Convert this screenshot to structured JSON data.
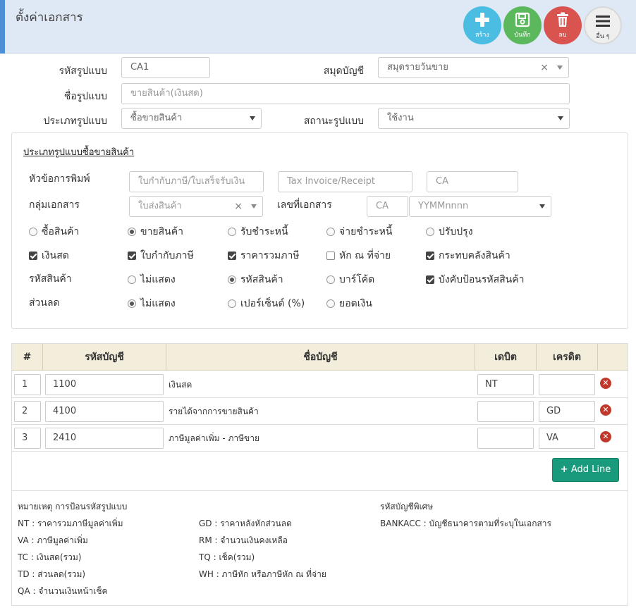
{
  "header": {
    "title": "ตั้งค่าเอกสาร",
    "buttons": {
      "create": "สร้าง",
      "save": "บันทึก",
      "delete": "ลบ",
      "more": "อื่น ๆ"
    }
  },
  "form": {
    "code_label": "รหัสรูปแบบ",
    "code_value": "CA1",
    "journal_label": "สมุดบัญชี",
    "journal_value": "สมุดรายวันขาย",
    "name_label": "ชื่อรูปแบบ",
    "name_placeholder": "ขายสินค้า(เงินสด)",
    "type_label": "ประเภทรูปแบบ",
    "type_value": "ซื้อขายสินค้า",
    "status_label": "สถานะรูปแบบ",
    "status_value": "ใช้งาน"
  },
  "panel": {
    "title": "ประเภทรูปแบบซื้อขายสินค้า",
    "print_title_label": "หัวข้อการพิมพ์",
    "print_title_th_placeholder": "ใบกำกับภาษี/ใบเสร็จรับเงิน",
    "print_title_en_placeholder": "Tax Invoice/Receipt",
    "print_title_code_placeholder": "CA",
    "doc_group_label": "กลุ่มเอกสาร",
    "doc_group_value": "ใบส่งสินค้า",
    "doc_no_label": "เลขที่เอกสาร",
    "doc_no_prefix": "CA",
    "doc_no_format": "YYMMnnnn",
    "trade_options": [
      {
        "label": "ซื้อสินค้า",
        "selected": false
      },
      {
        "label": "ขายสินค้า",
        "selected": true
      },
      {
        "label": "รับชำระหนี้",
        "selected": false
      },
      {
        "label": "จ่ายชำระหนี้",
        "selected": false
      },
      {
        "label": "ปรับปรุง",
        "selected": false
      }
    ],
    "checks": [
      {
        "label": "เงินสด",
        "checked": true
      },
      {
        "label": "ใบกำกับภาษี",
        "checked": true
      },
      {
        "label": "ราคารวมภาษี",
        "checked": true
      },
      {
        "label": "หัก ณ ที่จ่าย",
        "checked": false
      },
      {
        "label": "กระทบคลังสินค้า",
        "checked": true
      }
    ],
    "product_code_label": "รหัสสินค้า",
    "product_code_options": [
      {
        "label": "ไม่แสดง",
        "selected": false
      },
      {
        "label": "รหัสสินค้า",
        "selected": true
      },
      {
        "label": "บาร์โค้ด",
        "selected": false
      }
    ],
    "force_code": {
      "label": "บังคับป้อนรหัสสินค้า",
      "checked": true
    },
    "discount_label": "ส่วนลด",
    "discount_options": [
      {
        "label": "ไม่แสดง",
        "selected": true
      },
      {
        "label": "เปอร์เซ็นต์ (%)",
        "selected": false
      },
      {
        "label": "ยอดเงิน",
        "selected": false
      }
    ]
  },
  "table": {
    "headers": [
      "#",
      "รหัสบัญชี",
      "ชื่อบัญชี",
      "เดบิต",
      "เครดิต"
    ],
    "rows": [
      {
        "no": "1",
        "code": "1100",
        "name": "เงินสด",
        "debit": "NT",
        "credit": ""
      },
      {
        "no": "2",
        "code": "4100",
        "name": "รายได้จากการขายสินค้า",
        "debit": "",
        "credit": "GD"
      },
      {
        "no": "3",
        "code": "2410",
        "name": "ภาษีมูลค่าเพิ่ม - ภาษีขาย",
        "debit": "",
        "credit": "VA"
      }
    ],
    "add_line": "Add Line"
  },
  "notes": {
    "title": "หมายเหตุ การป้อนรหัสรูปแบบ",
    "col1": [
      "NT : ราคารวมภาษีมูลค่าเพิ่ม",
      "VA : ภาษีมูลค่าเพิ่ม",
      "TC : เงินสด(รวม)",
      "TD : ส่วนลด(รวม)",
      "QA : จำนวนเงินหน้าเช็ค"
    ],
    "col2": [
      "GD : ราคาหลังหักส่วนลด",
      "RM : จำนวนเงินคงเหลือ",
      "TQ : เช็ค(รวม)",
      "WH : ภาษีหัก หรือภาษีหัก ณ ที่จ่าย"
    ],
    "special_title": "รหัสบัญชีพิเศษ",
    "special": [
      "BANKACC : บัญชีธนาคารตามที่ระบุในเอกสาร"
    ]
  }
}
